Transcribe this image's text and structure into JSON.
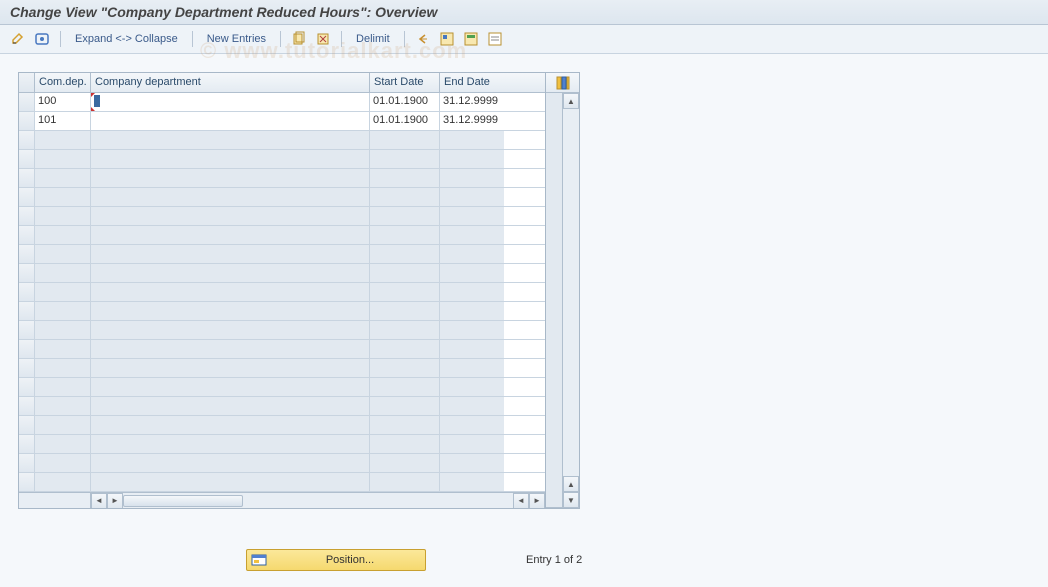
{
  "title": "Change View \"Company Department Reduced Hours\": Overview",
  "toolbar": {
    "expand_collapse": "Expand <-> Collapse",
    "new_entries": "New Entries",
    "delimit": "Delimit"
  },
  "table": {
    "headers": {
      "comdep": "Com.dep.",
      "company_department": "Company department",
      "start_date": "Start Date",
      "end_date": "End Date"
    },
    "rows": [
      {
        "comdep": "100",
        "company_department": "",
        "start_date": "01.01.1900",
        "end_date": "31.12.9999",
        "editing": true
      },
      {
        "comdep": "101",
        "company_department": "",
        "start_date": "01.01.1900",
        "end_date": "31.12.9999",
        "editing": false
      }
    ],
    "empty_rows": 19
  },
  "footer": {
    "position_button": "Position...",
    "entry_text": "Entry 1 of 2"
  },
  "watermark": "© www.tutorialkart.com"
}
